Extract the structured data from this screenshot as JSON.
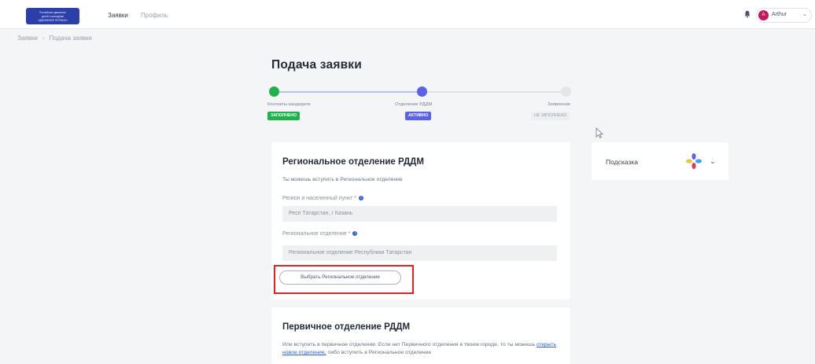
{
  "header": {
    "logo_lines": [
      "Российское движение",
      "детей и молодёжи",
      "«ДВИЖЕНИЕ ПЕРВЫХ»"
    ],
    "nav": [
      {
        "label": "Заявки",
        "active": true
      },
      {
        "label": "Профиль",
        "active": false
      }
    ],
    "user": {
      "avatar_letter": "А",
      "name": "Arthur",
      "chevron": "⌄"
    }
  },
  "breadcrumb": [
    "Заявки",
    "Подача заявки"
  ],
  "page_title": "Подача заявки",
  "stepper": {
    "steps": [
      {
        "label": "Контакты кандидата",
        "badge": "ЗАПОЛНЕНО",
        "state": "done"
      },
      {
        "label": "Отделение РДДМ",
        "badge": "АКТИВНО",
        "state": "active"
      },
      {
        "label": "Заявление",
        "badge": "НЕ ЗАПОЛНЕНО",
        "state": "pending"
      }
    ],
    "colors": {
      "done": "#20b24a",
      "active": "#5b62e8",
      "pending": "#d8dbe0"
    }
  },
  "regional_card": {
    "title": "Региональное отделение РДДМ",
    "description": "Ты можешь вступить в Региональное отделение",
    "region_label": "Регион и населенный пункт *",
    "region_value": "Респ Татарстан, г Казань",
    "office_label": "Региональное отделение *",
    "office_value": "Региональное отделение Республики Татарстан",
    "choose_button": "Выбрать Региональное отделение"
  },
  "primary_card": {
    "title": "Первичное отделение РДДМ",
    "text_before": "Или вступить в первичное отделение. Если нет Первичного отделения в твоем городе, то ты можешь",
    "link": "открыть новое отделение,",
    "text_after": "либо вступить в Региональное отделение"
  },
  "hint": {
    "label": "Подсказка",
    "chevron": "⌄"
  },
  "colors": {
    "accent": "#2b5fd9",
    "highlight": "#e02424",
    "logo_bg": "#2b3fa8"
  }
}
